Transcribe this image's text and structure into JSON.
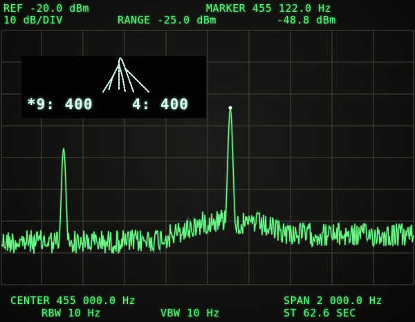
{
  "colors": {
    "trace": "#6cf585",
    "readout": "#5cf07a",
    "graticule": "#3a3c37",
    "inset_text": "#d8fff0"
  },
  "header": {
    "ref_level": "REF -20.0 dBm",
    "scale": "10 dB/DIV",
    "range": "RANGE -25.0 dBm",
    "marker_freq": "MARKER 455 122.0 Hz",
    "marker_level": "-48.8 dBm"
  },
  "inset": {
    "icon": "filter-shape-icon",
    "left_value": "*9: 400",
    "right_value": "4: 400"
  },
  "footer": {
    "center": "CENTER 455 000.0 Hz",
    "span": "SPAN 2 000.0 Hz",
    "rbw": "RBW 10 Hz",
    "vbw": "VBW 10 Hz",
    "sweep_time": "ST 62.6 SEC"
  }
}
